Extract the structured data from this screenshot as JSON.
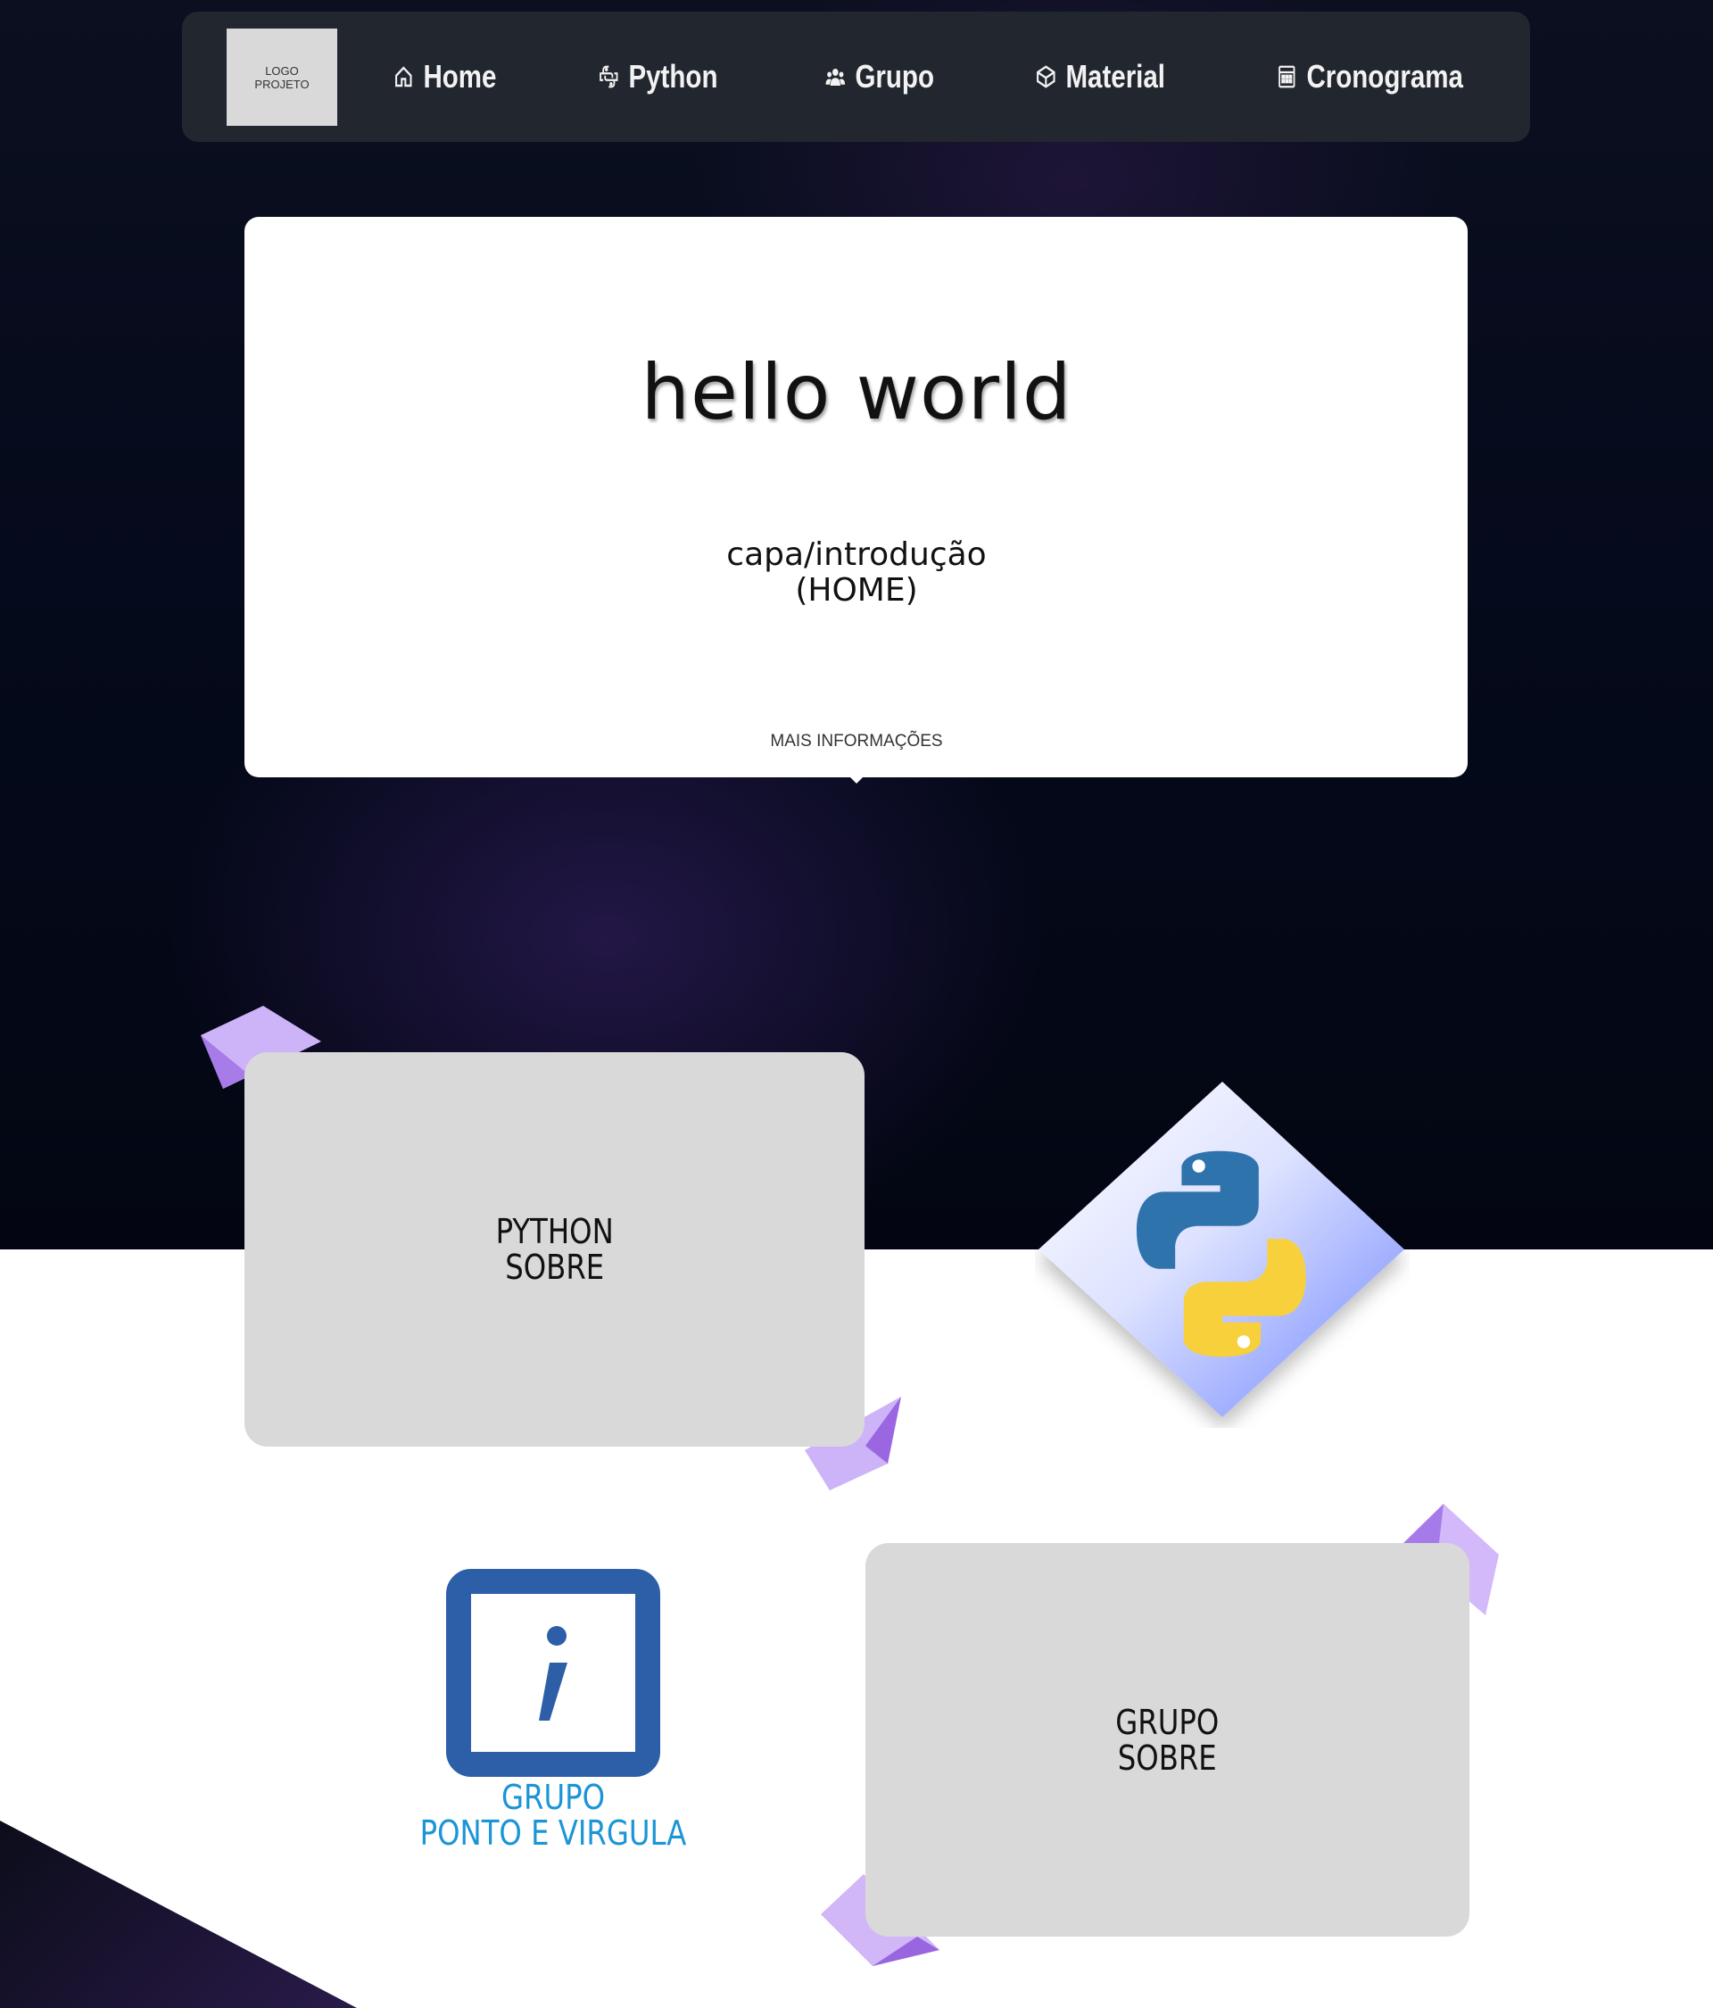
{
  "nav": {
    "logo_line1": "LOGO",
    "logo_line2": "PROJETO",
    "items": [
      {
        "label": "Home",
        "icon": "home-icon"
      },
      {
        "label": "Python",
        "icon": "python-icon"
      },
      {
        "label": "Grupo",
        "icon": "group-icon"
      },
      {
        "label": "Material",
        "icon": "material-icon"
      },
      {
        "label": "Cronograma",
        "icon": "calendar-icon"
      }
    ]
  },
  "hero": {
    "title": "hello world",
    "subtitle_line1": "capa/introdução",
    "subtitle_line2": "(HOME)",
    "more_label": "MAIS INFORMAÇÕES"
  },
  "cards": {
    "python_line1": "PYTHON",
    "python_line2": "SOBRE",
    "grupo_line1": "GRUPO",
    "grupo_line2": "SOBRE"
  },
  "group_logo": {
    "symbol": ";",
    "line1": "GRUPO",
    "line2": "PONTO E VIRGULA"
  },
  "colors": {
    "nav_bg": "#22262f",
    "card_bg": "#d9d9d9",
    "accent_purple": "#b794f4",
    "group_blue": "#2d5ea8",
    "group_text_blue": "#1b95d6"
  }
}
